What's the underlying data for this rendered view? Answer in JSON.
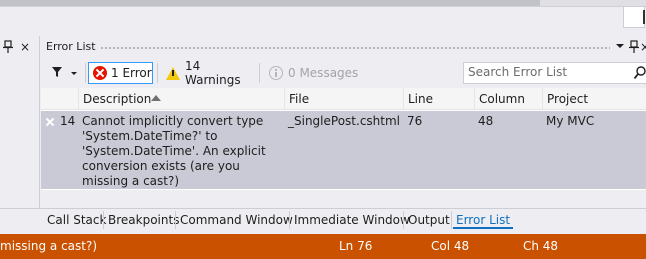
{
  "window": {
    "title": "Error List",
    "left_panel_close": "×",
    "title_close": "×"
  },
  "toolbar": {
    "errors_label": "1 Error",
    "warnings_label": "14 Warnings",
    "messages_label": "0 Messages",
    "search_placeholder": "Search Error List"
  },
  "grid": {
    "columns": [
      "Description",
      "File",
      "Line",
      "Column",
      "Project"
    ],
    "sorted_column": "Description",
    "sort_direction": "ascending",
    "rows": [
      {
        "type": "error",
        "code": "14",
        "description": "Cannot implicitly convert type 'System.DateTime?' to 'System.DateTime'. An explicit conversion exists (are you missing a cast?)",
        "file": "_SinglePost.cshtml",
        "line": "76",
        "column": "48",
        "project": "My MVC",
        "selected": true
      }
    ]
  },
  "tabs": [
    "Call Stack",
    "Breakpoints",
    "Command Window",
    "Immediate Window",
    "Output",
    "Error List"
  ],
  "active_tab": "Error List",
  "status": {
    "message": "missing a cast?)",
    "ln": "Ln 76",
    "col": "Col 48",
    "ch": "Ch 48"
  },
  "colors": {
    "accent": "#3399ff",
    "status_bar": "#ca5100",
    "error_icon": "#e51400",
    "warning_icon": "#f2c80f",
    "selected_row": "#c9cad5",
    "active_tab": "#0e70c0"
  },
  "icons": [
    "pin-icon",
    "close-icon",
    "filter-icon",
    "error-icon",
    "warning-icon",
    "info-icon",
    "search-icon",
    "sort-ascending-icon"
  ]
}
